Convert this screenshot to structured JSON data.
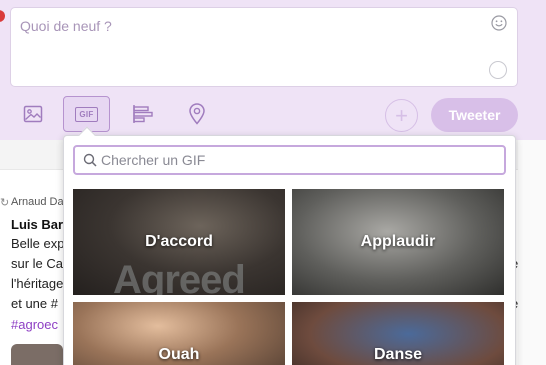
{
  "composer": {
    "placeholder": "Quoi de neuf ?",
    "tweet_button": "Tweeter",
    "add_button": "+",
    "toolbar": [
      "image-icon",
      "gif-icon",
      "poll-icon",
      "location-icon"
    ],
    "gif_label": "GIF"
  },
  "feed": {
    "retweeter": "Arnaud Da",
    "author": "Luis Bar",
    "lines": [
      "Belle exp",
      "sur le Ca",
      "l'héritage",
      "et une #",
      "#agroec"
    ],
    "hashtag_color": "#8e3fc4",
    "right_cut": [
      "e",
      "e"
    ]
  },
  "gif_picker": {
    "search_placeholder": "Chercher un GIF",
    "categories": [
      {
        "label": "D'accord",
        "overlay_text": "Agreed"
      },
      {
        "label": "Applaudir"
      },
      {
        "label": "Ouah"
      },
      {
        "label": "Danse"
      }
    ]
  },
  "colors": {
    "accent": "#b693cf",
    "composer_bg": "#efe3f6",
    "tweet_button_bg": "#d8bfe8"
  }
}
